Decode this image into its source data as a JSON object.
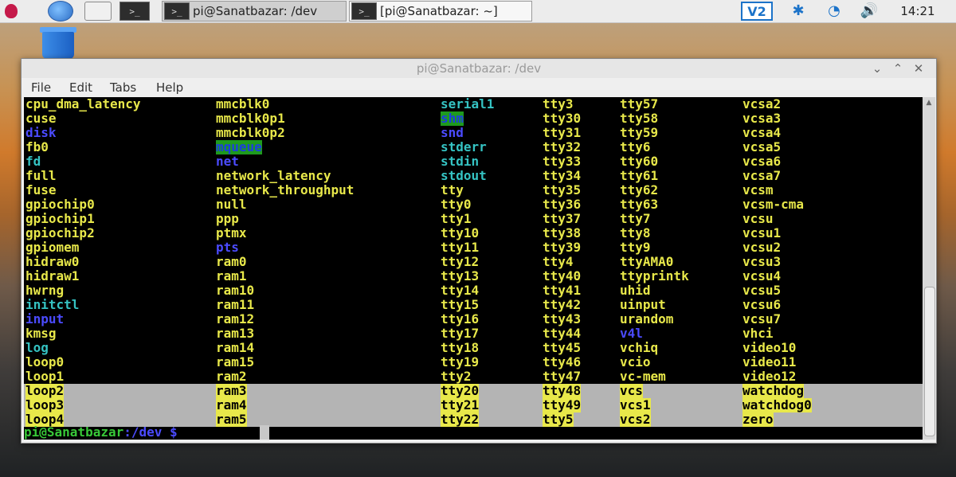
{
  "panel": {
    "task1_label": "pi@Sanatbazar: /dev",
    "task2_label": "[pi@Sanatbazar: ~]",
    "term_glyph": ">_",
    "vnc_label": "V2",
    "bluetooth_glyph": "✱",
    "wifi_glyph": "◔",
    "volume_glyph": "🔊",
    "clock": "14:21"
  },
  "window": {
    "title": "pi@Sanatbazar: /dev",
    "min_glyph": "⌄",
    "max_glyph": "⌃",
    "close_glyph": "✕",
    "menus": [
      "File",
      "Edit",
      "Tabs",
      "Help"
    ]
  },
  "terminal": {
    "rows": [
      [
        "cpu_dma_latency",
        "mmcblk0",
        "serial1",
        "tty3",
        "tty57",
        "vcsa2"
      ],
      [
        "cuse",
        "mmcblk0p1",
        "shm",
        "tty30",
        "tty58",
        "vcsa3"
      ],
      [
        "disk",
        "mmcblk0p2",
        "snd",
        "tty31",
        "tty59",
        "vcsa4"
      ],
      [
        "fb0",
        "mqueue",
        "stderr",
        "tty32",
        "tty6",
        "vcsa5"
      ],
      [
        "fd",
        "net",
        "stdin",
        "tty33",
        "tty60",
        "vcsa6"
      ],
      [
        "full",
        "network_latency",
        "stdout",
        "tty34",
        "tty61",
        "vcsa7"
      ],
      [
        "fuse",
        "network_throughput",
        "tty",
        "tty35",
        "tty62",
        "vcsm"
      ],
      [
        "gpiochip0",
        "null",
        "tty0",
        "tty36",
        "tty63",
        "vcsm-cma"
      ],
      [
        "gpiochip1",
        "ppp",
        "tty1",
        "tty37",
        "tty7",
        "vcsu"
      ],
      [
        "gpiochip2",
        "ptmx",
        "tty10",
        "tty38",
        "tty8",
        "vcsu1"
      ],
      [
        "gpiomem",
        "pts",
        "tty11",
        "tty39",
        "tty9",
        "vcsu2"
      ],
      [
        "hidraw0",
        "ram0",
        "tty12",
        "tty4",
        "ttyAMA0",
        "vcsu3"
      ],
      [
        "hidraw1",
        "ram1",
        "tty13",
        "tty40",
        "ttyprintk",
        "vcsu4"
      ],
      [
        "hwrng",
        "ram10",
        "tty14",
        "tty41",
        "uhid",
        "vcsu5"
      ],
      [
        "initctl",
        "ram11",
        "tty15",
        "tty42",
        "uinput",
        "vcsu6"
      ],
      [
        "input",
        "ram12",
        "tty16",
        "tty43",
        "urandom",
        "vcsu7"
      ],
      [
        "kmsg",
        "ram13",
        "tty17",
        "tty44",
        "v4l",
        "vhci"
      ],
      [
        "log",
        "ram14",
        "tty18",
        "tty45",
        "vchiq",
        "video10"
      ],
      [
        "loop0",
        "ram15",
        "tty19",
        "tty46",
        "vcio",
        "video11"
      ],
      [
        "loop1",
        "ram2",
        "tty2",
        "tty47",
        "vc-mem",
        "video12"
      ],
      [
        "loop2",
        "ram3",
        "tty20",
        "tty48",
        "vcs",
        "watchdog"
      ],
      [
        "loop3",
        "ram4",
        "tty21",
        "tty49",
        "vcs1",
        "watchdog0"
      ],
      [
        "loop4",
        "ram5",
        "tty22",
        "tty5",
        "vcs2",
        "zero"
      ]
    ],
    "prompt_user": "pi@Sanatbazar",
    "prompt_path": ":/dev $",
    "cyan_entries": [
      "serial1",
      "stderr",
      "stdin",
      "stdout",
      "fd",
      "initctl",
      "log"
    ],
    "blue_entries": [
      "disk",
      "snd",
      "input",
      "net",
      "pts",
      "v4l"
    ],
    "green_bg_entries": [
      "shm",
      "mqueue"
    ]
  },
  "colors": {
    "file_yellow": "#e8e84a",
    "link_cyan": "#35c3c3",
    "dir_blue": "#4b4bff",
    "sticky_green": "#1e9a1e",
    "prompt_green": "#38c838"
  }
}
